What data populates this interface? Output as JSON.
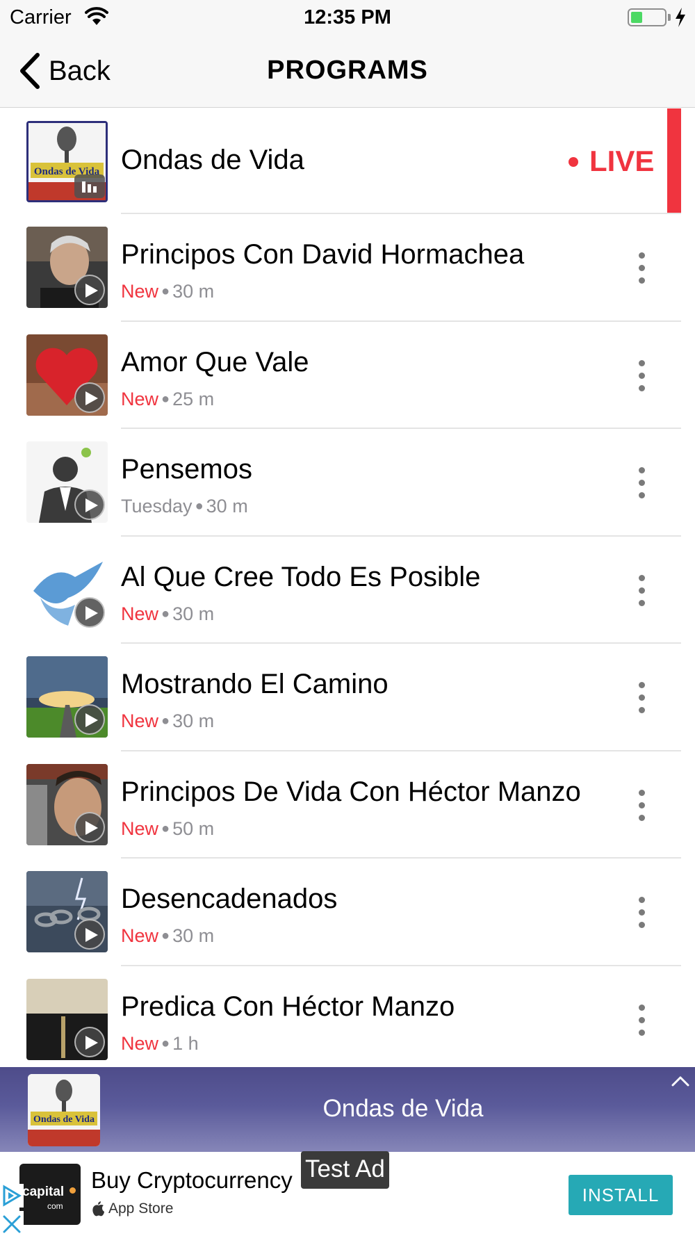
{
  "status_bar": {
    "carrier": "Carrier",
    "time": "12:35 PM",
    "battery_color": "#4cd964"
  },
  "nav": {
    "back_label": "Back",
    "title": "PROGRAMS"
  },
  "colors": {
    "accent_red": "#f0343f",
    "secondary_text": "#8e8e93",
    "install_button": "#26a9b5"
  },
  "live_program": {
    "title": "Ondas de Vida",
    "live_label": "LIVE",
    "thumb_caption": "Ondas de Vida"
  },
  "programs": [
    {
      "title": "Principos Con David Hormachea",
      "status": "New",
      "duration": "30 m"
    },
    {
      "title": "Amor Que Vale",
      "status": "New",
      "duration": "25 m"
    },
    {
      "title": "Pensemos",
      "status": "Tuesday",
      "duration": "30 m"
    },
    {
      "title": "Al Que Cree Todo Es Posible",
      "status": "New",
      "duration": "30 m"
    },
    {
      "title": "Mostrando El Camino",
      "status": "New",
      "duration": "30 m"
    },
    {
      "title": "Principos De Vida Con Héctor Manzo",
      "status": "New",
      "duration": "50 m"
    },
    {
      "title": "Desencadenados",
      "status": "New",
      "duration": "30 m"
    },
    {
      "title": "Predica Con Héctor Manzo",
      "status": "New",
      "duration": "1 h"
    }
  ],
  "mini_player": {
    "title": "Ondas de Vida"
  },
  "ad": {
    "title": "Buy Cryptocurrency",
    "store": "App Store",
    "install_label": "INSTALL",
    "test_label": "Test Ad",
    "logo_text": "capital",
    "logo_suffix": "com"
  }
}
